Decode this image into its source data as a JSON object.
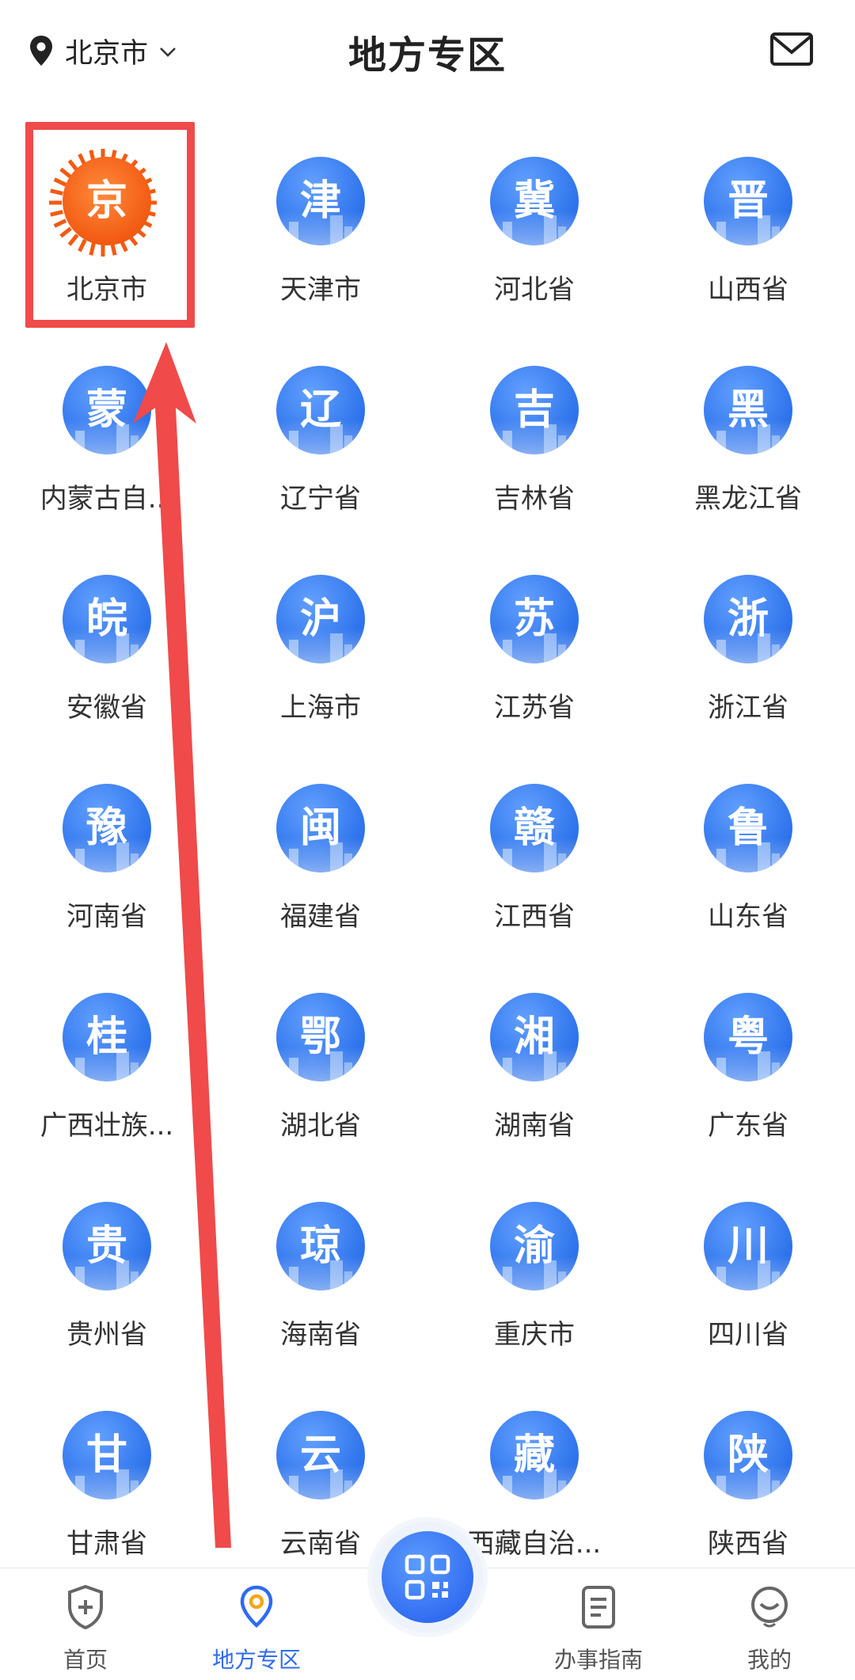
{
  "header": {
    "location": "北京市",
    "title": "地方专区"
  },
  "regions": [
    {
      "glyph": "京",
      "label": "北京市",
      "style": "orange"
    },
    {
      "glyph": "津",
      "label": "天津市"
    },
    {
      "glyph": "冀",
      "label": "河北省"
    },
    {
      "glyph": "晋",
      "label": "山西省"
    },
    {
      "glyph": "蒙",
      "label": "内蒙古自..."
    },
    {
      "glyph": "辽",
      "label": "辽宁省"
    },
    {
      "glyph": "吉",
      "label": "吉林省"
    },
    {
      "glyph": "黑",
      "label": "黑龙江省"
    },
    {
      "glyph": "皖",
      "label": "安徽省"
    },
    {
      "glyph": "沪",
      "label": "上海市"
    },
    {
      "glyph": "苏",
      "label": "江苏省"
    },
    {
      "glyph": "浙",
      "label": "浙江省"
    },
    {
      "glyph": "豫",
      "label": "河南省"
    },
    {
      "glyph": "闽",
      "label": "福建省"
    },
    {
      "glyph": "赣",
      "label": "江西省"
    },
    {
      "glyph": "鲁",
      "label": "山东省"
    },
    {
      "glyph": "桂",
      "label": "广西壮族..."
    },
    {
      "glyph": "鄂",
      "label": "湖北省"
    },
    {
      "glyph": "湘",
      "label": "湖南省"
    },
    {
      "glyph": "粤",
      "label": "广东省"
    },
    {
      "glyph": "贵",
      "label": "贵州省"
    },
    {
      "glyph": "琼",
      "label": "海南省"
    },
    {
      "glyph": "渝",
      "label": "重庆市"
    },
    {
      "glyph": "川",
      "label": "四川省"
    },
    {
      "glyph": "甘",
      "label": "甘肃省"
    },
    {
      "glyph": "云",
      "label": "云南省"
    },
    {
      "glyph": "藏",
      "label": "西藏自治..."
    },
    {
      "glyph": "陕",
      "label": "陕西省"
    }
  ],
  "tabbar": {
    "home": "首页",
    "local": "地方专区",
    "guide": "办事指南",
    "mine": "我的",
    "active": "local"
  },
  "colors": {
    "accent": "#2f6bf0",
    "annotation": "#f04a4a",
    "beijing_orange": "#f25a12"
  },
  "icons": [
    "location-pin-icon",
    "chevron-down-icon",
    "mail-icon",
    "shield-plus-icon",
    "map-pin-icon",
    "qr-code-icon",
    "document-icon",
    "smile-icon"
  ]
}
